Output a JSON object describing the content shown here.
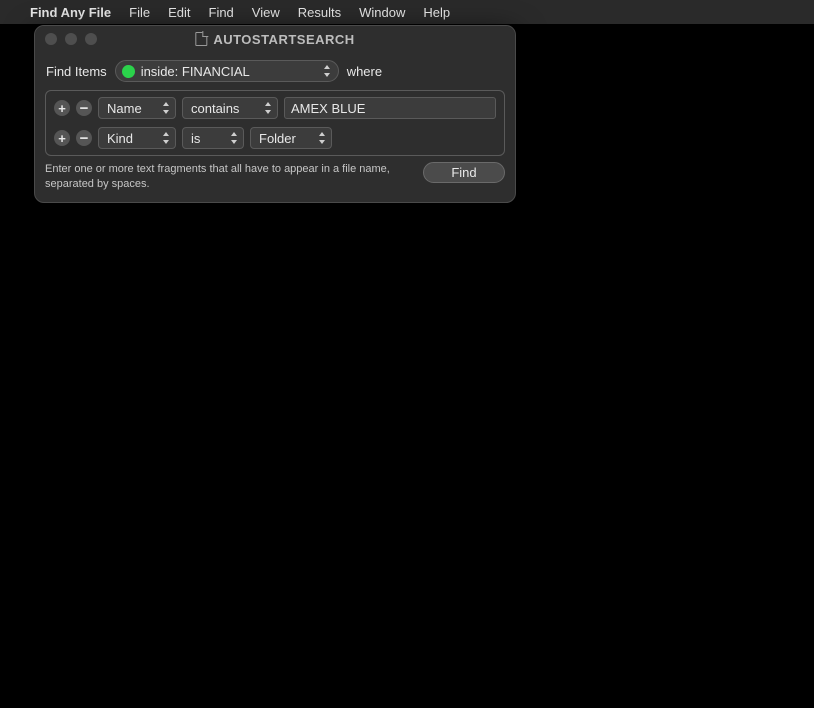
{
  "menubar": {
    "app_name": "Find Any File",
    "items": [
      "File",
      "Edit",
      "Find",
      "View",
      "Results",
      "Window",
      "Help"
    ]
  },
  "window": {
    "title": "AUTOSTARTSEARCH"
  },
  "search": {
    "find_items_label": "Find Items",
    "scope": "inside: FINANCIAL",
    "where_label": "where"
  },
  "criteria": [
    {
      "attribute": "Name",
      "operator": "contains",
      "value": "AMEX BLUE",
      "value_kind": "text"
    },
    {
      "attribute": "Kind",
      "operator": "is",
      "value": "Folder",
      "value_kind": "popup"
    }
  ],
  "footer": {
    "hint": "Enter one or more text fragments that all have to appear in a file name, separated by spaces.",
    "find_label": "Find"
  }
}
